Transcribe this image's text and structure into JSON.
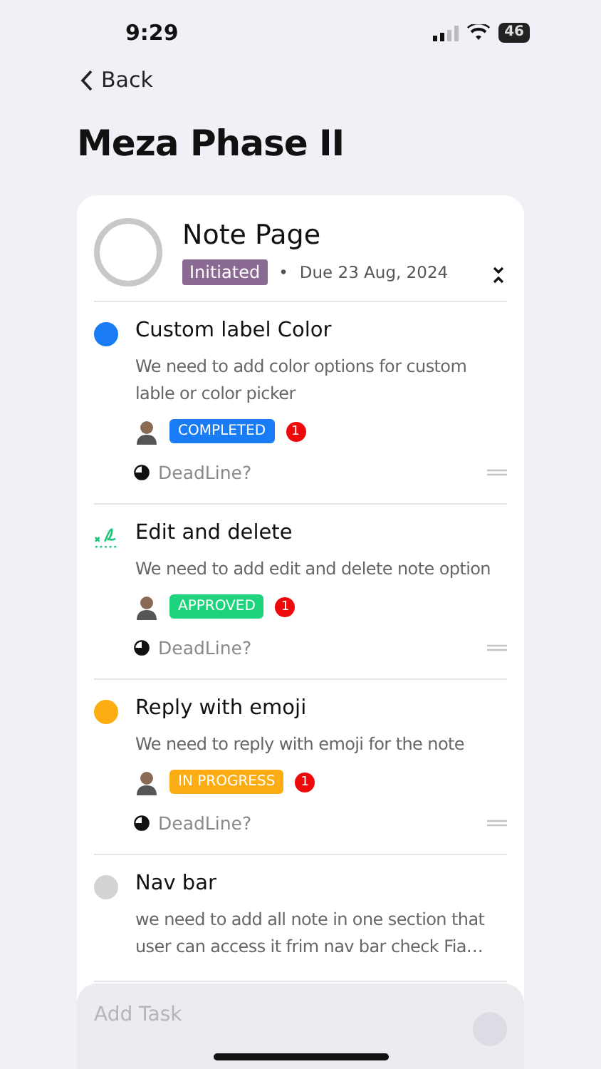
{
  "status_bar": {
    "time": "9:29",
    "battery": "46"
  },
  "nav": {
    "back": "Back"
  },
  "title": "Meza Phase II",
  "project": {
    "name": "Note Page",
    "status": "Initiated",
    "separator": "•",
    "due": "Due 23 Aug, 2024"
  },
  "tasks": [
    {
      "kind": "dot",
      "color": "#1a7cf5",
      "title": "Custom label Color",
      "description": "We need to add color options for custom lable or color picker",
      "status": {
        "label": "COMPLETED",
        "color": "#1a7cf5"
      },
      "count": "1",
      "deadline": "DeadLine?"
    },
    {
      "kind": "sign",
      "title": "Edit and delete",
      "description": "We need to add edit and delete note option",
      "status": {
        "label": "APPROVED",
        "color": "#1dd47c"
      },
      "count": "1",
      "deadline": "DeadLine?"
    },
    {
      "kind": "dot",
      "color": "#fbad13",
      "title": "Reply with emoji",
      "description": "We need to reply with emoji for the note",
      "status": {
        "label": "IN PROGRESS",
        "color": "#fbad13"
      },
      "count": "1",
      "deadline": "DeadLine?"
    },
    {
      "kind": "dot",
      "color": "#d3d3d3",
      "title": "Nav bar",
      "description": "we need to add all note in one section that user can access it frim nav bar check Fia…"
    }
  ],
  "add_task": {
    "placeholder": "Add Task"
  }
}
